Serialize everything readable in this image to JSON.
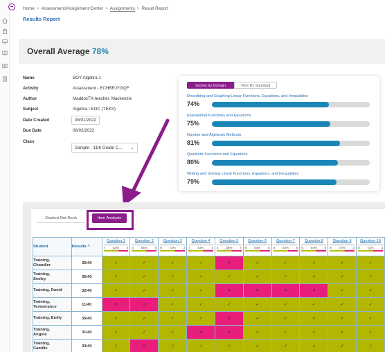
{
  "breadcrumb": {
    "home": "Home",
    "center": "Assessment/Assignment Center",
    "assignments": "Assignments",
    "current": "Result Report"
  },
  "page_title": "Results Report",
  "overall": {
    "label": "Overall Average",
    "value": "78%"
  },
  "meta": {
    "name_label": "Name",
    "name_value": "BOY Algebra 1",
    "activity_label": "Activity",
    "activity_value": "Assessment - ECHBRJYGQF",
    "author_label": "Author",
    "author_value": "MaddoxTX-teacher, Mackenzie",
    "subject_label": "Subject",
    "subject_value": "Algebra I EOC (TEKS)",
    "date_created_label": "Date Created",
    "date_created_value": "08/01/2022",
    "due_date_label": "Due Date",
    "due_date_value": "08/03/2022",
    "class_label": "Class",
    "class_value": "Sample - 11th Grade C..."
  },
  "domain_panel": {
    "tab_active": "Scores by Domain",
    "tab_inactive": "View By Standard",
    "domains": [
      {
        "name": "Describing and Graphing Linear Functions, Equations, and Inequalities",
        "pct_label": "74%",
        "pct": 0.74
      },
      {
        "name": "Exponential Functions and Equations",
        "pct_label": "75%",
        "pct": 0.75
      },
      {
        "name": "Number and Algebraic Methods",
        "pct_label": "81%",
        "pct": 0.81
      },
      {
        "name": "Quadratic Functions and Equations",
        "pct_label": "80%",
        "pct": 0.8
      },
      {
        "name": "Writing and Solving Linear Functions, Equations, and Inequalities",
        "pct_label": "79%",
        "pct": 0.79
      }
    ]
  },
  "lower_tabs": {
    "dot_rank": "Student Dot Rank",
    "item_analysis": "Item Analysis"
  },
  "grid": {
    "student_header": "Student",
    "results_header": "Results ^",
    "questions": [
      {
        "name": "Question 1",
        "left": "7",
        "mid": "63%",
        "right": "4"
      },
      {
        "name": "Question 2",
        "left": "6",
        "mid": "54%",
        "right": "5"
      },
      {
        "name": "Question 3",
        "left": "8",
        "mid": "72%",
        "right": "3"
      },
      {
        "name": "Question 4",
        "left": "7",
        "mid": "63%",
        "right": "4"
      },
      {
        "name": "Question 5",
        "left": "4",
        "mid": "36%",
        "right": "7"
      },
      {
        "name": "Question 6",
        "left": "6",
        "mid": "54%",
        "right": "5"
      },
      {
        "name": "Question 7",
        "left": "6",
        "mid": "54%",
        "right": "5"
      },
      {
        "name": "Question 8",
        "left": "6",
        "mid": "54%",
        "right": "5"
      },
      {
        "name": "Question 9",
        "left": "8",
        "mid": "72%",
        "right": "3"
      },
      {
        "name": "Question 10",
        "left": "8",
        "mid": "72%",
        "right": "3"
      }
    ],
    "check_mark": "✓",
    "cross_mark": "✕",
    "rows": [
      {
        "last": "Training,",
        "first": "Chandler",
        "score": "35/40",
        "results": [
          1,
          1,
          1,
          1,
          0,
          1,
          1,
          1,
          1,
          1
        ]
      },
      {
        "last": "Training,",
        "first": "Seeley",
        "score": "35/40",
        "results": [
          1,
          1,
          1,
          1,
          1,
          1,
          1,
          1,
          1,
          1
        ]
      },
      {
        "last": "Training, David",
        "first": "",
        "score": "32/40",
        "results": [
          1,
          1,
          1,
          1,
          0,
          0,
          0,
          0,
          1,
          1
        ]
      },
      {
        "last": "Training,",
        "first": "Temperance",
        "score": "11/40",
        "results": [
          0,
          0,
          1,
          1,
          1,
          1,
          1,
          1,
          1,
          1
        ]
      },
      {
        "last": "Training, Emily",
        "first": "",
        "score": "35/40",
        "results": [
          1,
          1,
          1,
          1,
          0,
          1,
          1,
          1,
          1,
          1
        ]
      },
      {
        "last": "Training,",
        "first": "Angela",
        "score": "31/40",
        "results": [
          1,
          1,
          1,
          0,
          0,
          1,
          1,
          1,
          1,
          1
        ]
      },
      {
        "last": "Training,",
        "first": "Camille",
        "score": "33/40",
        "results": [
          1,
          0,
          1,
          1,
          1,
          1,
          1,
          1,
          1,
          1
        ]
      }
    ]
  }
}
